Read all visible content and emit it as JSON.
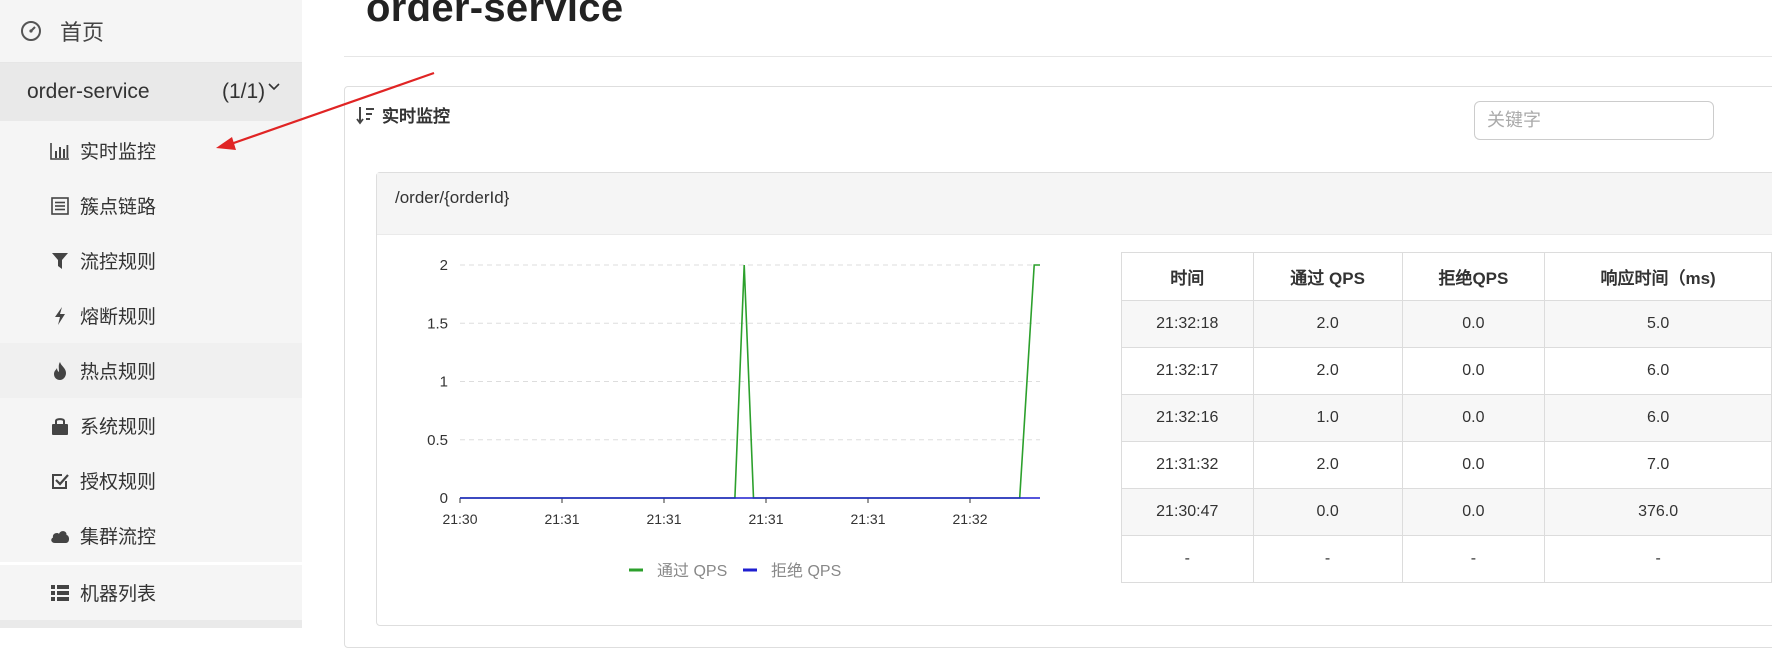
{
  "sidebar": {
    "home_label": "首页",
    "app": {
      "name": "order-service",
      "count": "(1/1)"
    },
    "items": [
      {
        "label": "实时监控",
        "icon": "bar-chart-icon"
      },
      {
        "label": "簇点链路",
        "icon": "list-icon"
      },
      {
        "label": "流控规则",
        "icon": "filter-icon"
      },
      {
        "label": "熔断规则",
        "icon": "bolt-icon"
      },
      {
        "label": "热点规则",
        "icon": "fire-icon"
      },
      {
        "label": "系统规则",
        "icon": "lock-icon"
      },
      {
        "label": "授权规则",
        "icon": "check-square-icon"
      },
      {
        "label": "集群流控",
        "icon": "cloud-icon"
      },
      {
        "label": "机器列表",
        "icon": "th-list-icon"
      }
    ]
  },
  "main": {
    "title": "order-service",
    "panel_title": "实时监控",
    "search_placeholder": "关键字",
    "resource": "/order/{orderId}"
  },
  "table": {
    "headers": [
      "时间",
      "通过 QPS",
      "拒绝QPS",
      "响应时间（ms)"
    ],
    "rows": [
      [
        "21:32:18",
        "2.0",
        "0.0",
        "5.0"
      ],
      [
        "21:32:17",
        "2.0",
        "0.0",
        "6.0"
      ],
      [
        "21:32:16",
        "1.0",
        "0.0",
        "6.0"
      ],
      [
        "21:31:32",
        "2.0",
        "0.0",
        "7.0"
      ],
      [
        "21:30:47",
        "0.0",
        "0.0",
        "376.0"
      ],
      [
        "-",
        "-",
        "-",
        "-"
      ]
    ]
  },
  "colors": {
    "pass": "#2ca02c",
    "reject": "#1f1fd0",
    "arrow": "#e02424"
  },
  "chart_data": {
    "type": "line",
    "x_ticks": [
      "21:30",
      "21:31",
      "21:31",
      "21:31",
      "21:31",
      "21:32"
    ],
    "y_ticks": [
      "2",
      "1.5",
      "1",
      "0.5",
      "0"
    ],
    "ylim": [
      0,
      2
    ],
    "grid": true,
    "legend_position": "bottom",
    "series": [
      {
        "name": "通过 QPS",
        "color": "#2ca02c",
        "points": [
          [
            0,
            0
          ],
          [
            0.474,
            0
          ],
          [
            0.49,
            2
          ],
          [
            0.506,
            0
          ],
          [
            0.965,
            0
          ],
          [
            0.99,
            2
          ],
          [
            1,
            2
          ]
        ]
      },
      {
        "name": "拒绝 QPS",
        "color": "#1f1fd0",
        "points": [
          [
            0,
            0
          ],
          [
            1,
            0
          ]
        ]
      }
    ]
  }
}
